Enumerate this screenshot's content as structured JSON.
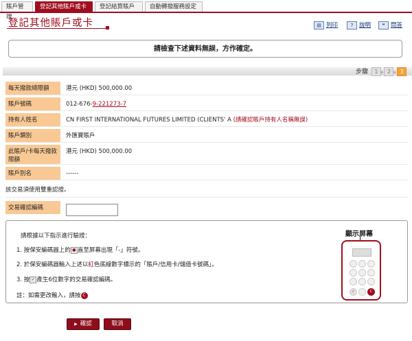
{
  "tabs": [
    "賬戶管理",
    "登記其他賬戶或卡",
    "登記結算賬戶",
    "自動轉撥服務設定"
  ],
  "page_title": "登記其他賬戶或卡",
  "toolbar": {
    "print": "列印",
    "help": "說明",
    "faq": "問答"
  },
  "notice": "請檢查下述資料無誤，方作確定。",
  "steps": {
    "label": "步驟",
    "items": [
      "1",
      "2",
      "3"
    ],
    "current": "3"
  },
  "fields": [
    {
      "label": "每天撥款總限額",
      "value": "港元 (HKD) 500,000.00"
    },
    {
      "label": "賬戶號碼",
      "value_prefix": "012-676-",
      "value_highlight": "9-221273-7"
    },
    {
      "label": "持有人姓名",
      "value": "CN FIRST INTERNATIONAL FUTURES LIMITED (CLIENTS' A",
      "warning": "(請確認賬戶持有人名稱無誤)"
    },
    {
      "label": "賬戶類別",
      "value": "外匯寶賬戶"
    },
    {
      "label": "此賬戶/卡每天撥款限額",
      "value": "港元 (HKD) 500,000.00"
    },
    {
      "label": "賬戶別名",
      "value": "------"
    }
  ],
  "auth_note": "該交易須使用雙重認證。",
  "confirm_code_label": "交易確認編碼",
  "confirm_code_value": "",
  "instructions": {
    "heading": "請根據以下指示進行驗證：",
    "step1_a": "1. 按保安編碼器上的",
    "step1_b": "直至屏幕出現「-」符號。",
    "step2_a": "2. 於保安編碼器輸入上述以",
    "step2_red": "紅",
    "step2_b": "色底線數字標示的「賬戶/信用卡/儲值卡號碼」。",
    "step3_a": "3. 按",
    "step3_b": "產生6位數字的交易確認編碼。",
    "note": "註：如需更改輸入，請按"
  },
  "device_label": "顯示屏幕",
  "buttons": {
    "confirm": "確認",
    "cancel": "取消"
  },
  "colors": {
    "brand": "#a00d1e",
    "label_bg": "#f8c995",
    "step_current": "#f4a23b"
  }
}
